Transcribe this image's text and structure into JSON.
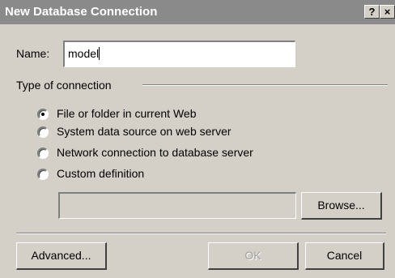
{
  "window": {
    "title": "New Database Connection",
    "help_button": "?",
    "close_button": "×"
  },
  "name_field": {
    "label": "Name:",
    "value": "model"
  },
  "connection_type": {
    "group_label": "Type of connection",
    "options": [
      {
        "label": "File or folder in current Web",
        "selected": true
      },
      {
        "label": "System data source on web server",
        "selected": false
      },
      {
        "label": "Network connection to database server",
        "selected": false
      },
      {
        "label": "Custom definition",
        "selected": false
      }
    ],
    "custom_value": "",
    "browse_label": "Browse..."
  },
  "buttons": {
    "advanced": "Advanced...",
    "ok": "OK",
    "cancel": "Cancel"
  }
}
